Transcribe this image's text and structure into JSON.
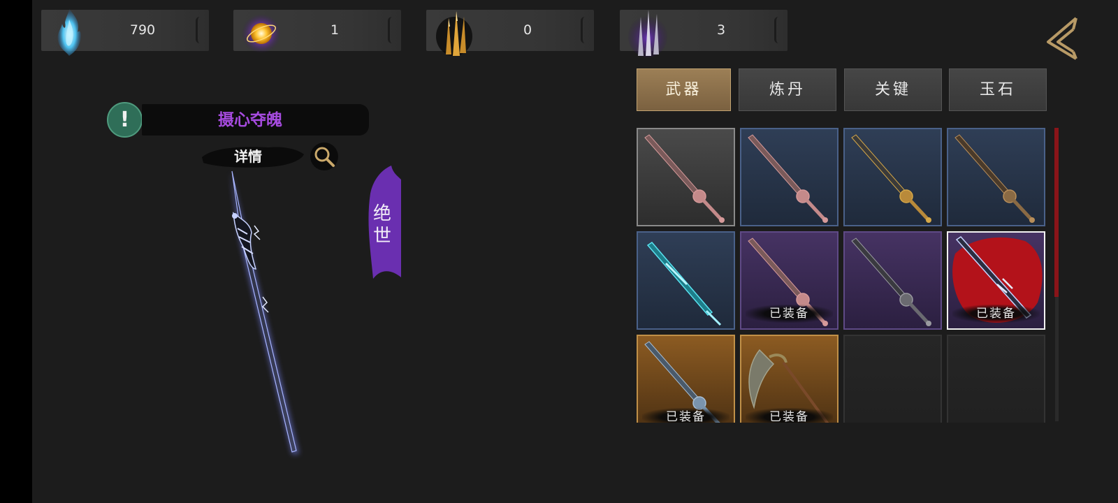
{
  "currencies": [
    {
      "icon": "blue-soul-flame-icon",
      "value": "790"
    },
    {
      "icon": "golden-orb-icon",
      "value": "1"
    },
    {
      "icon": "golden-blades-icon",
      "value": "0"
    },
    {
      "icon": "purple-blades-icon",
      "value": "3"
    }
  ],
  "back_button": {
    "icon": "back-arrow-icon"
  },
  "selected_item": {
    "skill_name": "摄心夺魄",
    "details_label": "详情",
    "rarity": "绝\n世"
  },
  "tabs": [
    {
      "label": "武器",
      "active": true
    },
    {
      "label": "炼丹",
      "active": false
    },
    {
      "label": "关键",
      "active": false
    },
    {
      "label": "玉石",
      "active": false
    }
  ],
  "equipped_label": "已装备",
  "slots": [
    {
      "rarity": "common",
      "weapon": "sword-pink-hilt",
      "equipped": false,
      "selected": false
    },
    {
      "rarity": "rare",
      "weapon": "sword-pink-hilt",
      "equipped": false,
      "selected": false
    },
    {
      "rarity": "rare",
      "weapon": "sword-gold-guard",
      "equipped": false,
      "selected": false
    },
    {
      "rarity": "rare",
      "weapon": "sword-bronze-ring",
      "equipped": false,
      "selected": false
    },
    {
      "rarity": "rare",
      "weapon": "cyan-crystal-blade",
      "equipped": false,
      "selected": false
    },
    {
      "rarity": "epic",
      "weapon": "sword-pink-hilt",
      "equipped": true,
      "selected": false
    },
    {
      "rarity": "epic",
      "weapon": "sword-dark-guard",
      "equipped": false,
      "selected": false
    },
    {
      "rarity": "epic",
      "weapon": "lightning-blade",
      "equipped": true,
      "selected": true
    },
    {
      "rarity": "legendary",
      "weapon": "blue-steel-sword",
      "equipped": true,
      "selected": false
    },
    {
      "rarity": "legendary",
      "weapon": "horsetail-whisk",
      "equipped": true,
      "selected": false
    },
    {
      "rarity": "empty",
      "weapon": "",
      "equipped": false,
      "selected": false
    },
    {
      "rarity": "empty",
      "weapon": "",
      "equipped": false,
      "selected": false
    }
  ],
  "colors": {
    "rarity_common": "#3a3a3a",
    "rarity_rare": "#27344a",
    "rarity_epic": "#35284a",
    "rarity_legendary": "#7a4e1e",
    "rarity_highlight": "#8d50d8",
    "tab_active": "#8f7550",
    "scrollbar_accent": "#8a1419"
  }
}
